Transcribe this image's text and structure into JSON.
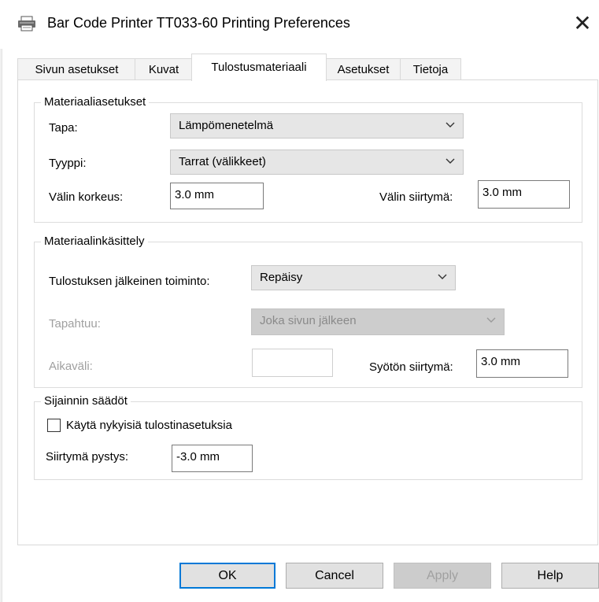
{
  "window": {
    "title": "Bar Code Printer TT033-60 Printing Preferences",
    "close_label": "✕",
    "icon": "printer-icon"
  },
  "tabs": [
    {
      "label": "Sivun asetukset",
      "active": false
    },
    {
      "label": "Kuvat",
      "active": false
    },
    {
      "label": "Tulostusmateriaali",
      "active": true
    },
    {
      "label": "Asetukset",
      "active": false
    },
    {
      "label": "Tietoja",
      "active": false
    }
  ],
  "media_settings": {
    "legend": "Materiaaliasetukset",
    "method_label": "Tapa:",
    "method_value": "Lämpömenetelmä",
    "type_label": "Tyyppi:",
    "type_value": "Tarrat (välikkeet)",
    "gap_height_label": "Välin korkeus:",
    "gap_height_value": "3.0 mm",
    "gap_offset_label": "Välin siirtymä:",
    "gap_offset_value": "3.0 mm"
  },
  "media_handling": {
    "legend": "Materiaalinkäsittely",
    "post_print_label": "Tulostuksen jälkeinen toiminto:",
    "post_print_value": "Repäisy",
    "occurs_label": "Tapahtuu:",
    "occurs_value": "Joka sivun jälkeen",
    "interval_label": "Aikaväli:",
    "interval_value": "",
    "feed_offset_label": "Syötön siirtymä:",
    "feed_offset_value": "3.0 mm"
  },
  "position_adjust": {
    "legend": "Sijainnin säädöt",
    "use_current_label": "Käytä nykyisiä tulostinasetuksia",
    "use_current_checked": false,
    "vertical_offset_label": "Siirtymä pystys:",
    "vertical_offset_value": "-3.0 mm"
  },
  "buttons": {
    "ok": "OK",
    "cancel": "Cancel",
    "apply": "Apply",
    "help": "Help"
  },
  "colors": {
    "default_button_border": "#0078d7",
    "disabled_text": "#a0a0a0"
  }
}
